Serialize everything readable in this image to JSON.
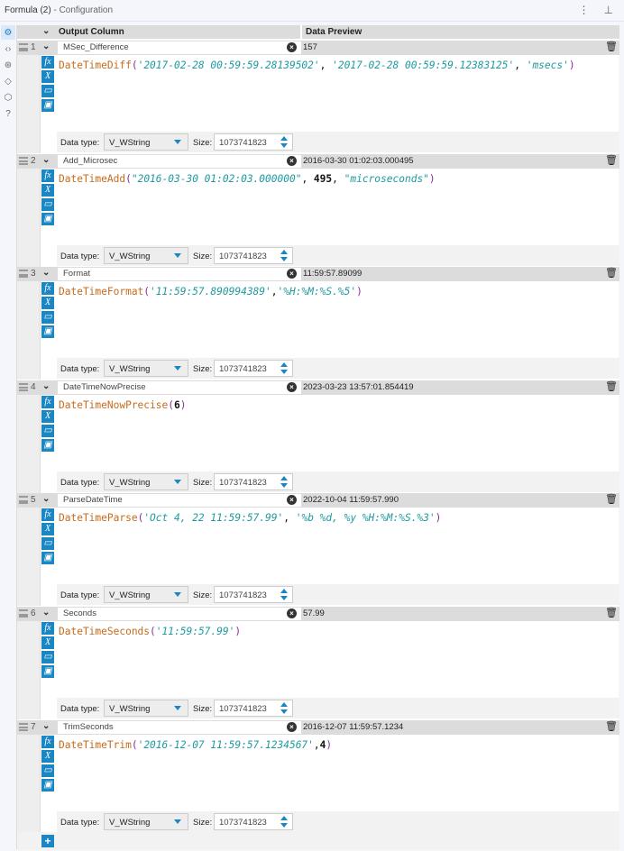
{
  "header": {
    "title": "Formula (2)",
    "subtitle": "- Configuration"
  },
  "table": {
    "col_output": "Output Column",
    "col_preview": "Data Preview"
  },
  "labels": {
    "data_type": "Data type:",
    "size": "Size:"
  },
  "rows": [
    {
      "num": "1",
      "name": "MSec_Difference",
      "preview": "157",
      "type": "V_WString",
      "size": "1073741823",
      "formula": [
        {
          "t": "DateTimeDiff",
          "c": "fn"
        },
        {
          "t": "(",
          "c": "pn"
        },
        {
          "t": "'2017-02-28 00:59:59.28139502'",
          "c": "str"
        },
        {
          "t": ", ",
          "c": "pl"
        },
        {
          "t": "'2017-02-28 00:59:59.12383125'",
          "c": "str"
        },
        {
          "t": ", ",
          "c": "pl"
        },
        {
          "t": "'msecs'",
          "c": "str"
        },
        {
          "t": ")",
          "c": "pn"
        }
      ]
    },
    {
      "num": "2",
      "name": "Add_Microsec",
      "preview": "2016-03-30 01:02:03.000495",
      "type": "V_WString",
      "size": "1073741823",
      "formula": [
        {
          "t": "DateTimeAdd",
          "c": "fn"
        },
        {
          "t": "(",
          "c": "pn"
        },
        {
          "t": "\"2016-03-30 01:02:03.000000\"",
          "c": "str"
        },
        {
          "t": ", ",
          "c": "pl"
        },
        {
          "t": "495",
          "c": "num-t"
        },
        {
          "t": ", ",
          "c": "pl"
        },
        {
          "t": "\"microseconds\"",
          "c": "str"
        },
        {
          "t": ")",
          "c": "pn"
        }
      ]
    },
    {
      "num": "3",
      "name": "Format",
      "preview": "11:59:57.89099",
      "type": "V_WString",
      "size": "1073741823",
      "formula": [
        {
          "t": "DateTimeFormat",
          "c": "fn"
        },
        {
          "t": "(",
          "c": "pn"
        },
        {
          "t": "'11:59:57.890994389'",
          "c": "str"
        },
        {
          "t": ",",
          "c": "pl"
        },
        {
          "t": "'%H:%M:%S.%5'",
          "c": "str"
        },
        {
          "t": ")",
          "c": "pn"
        }
      ]
    },
    {
      "num": "4",
      "name": "DateTimeNowPrecise",
      "preview": "2023-03-23 13:57:01.854419",
      "type": "V_WString",
      "size": "1073741823",
      "formula": [
        {
          "t": "DateTimeNowPrecise",
          "c": "fn"
        },
        {
          "t": "(",
          "c": "pn"
        },
        {
          "t": "6",
          "c": "num-t"
        },
        {
          "t": ")",
          "c": "pn"
        }
      ]
    },
    {
      "num": "5",
      "name": "ParseDateTime",
      "preview": "2022-10-04 11:59:57.990",
      "type": "V_WString",
      "size": "1073741823",
      "formula": [
        {
          "t": "DateTimeParse",
          "c": "fn"
        },
        {
          "t": "(",
          "c": "pn"
        },
        {
          "t": "'Oct 4, 22 11:59:57.99'",
          "c": "str"
        },
        {
          "t": ", ",
          "c": "pl"
        },
        {
          "t": "'%b %d, %y %H:%M:%S.%3'",
          "c": "str"
        },
        {
          "t": ")",
          "c": "pn"
        }
      ]
    },
    {
      "num": "6",
      "name": "Seconds",
      "preview": "57.99",
      "type": "V_WString",
      "size": "1073741823",
      "formula": [
        {
          "t": "DateTimeSeconds",
          "c": "fn"
        },
        {
          "t": "(",
          "c": "pn"
        },
        {
          "t": "'11:59:57.99'",
          "c": "str"
        },
        {
          "t": ")",
          "c": "pn"
        }
      ]
    },
    {
      "num": "7",
      "name": "TrimSeconds",
      "preview": "2016-12-07 11:59:57.1234",
      "type": "V_WString",
      "size": "1073741823",
      "formula": [
        {
          "t": "DateTimeTrim",
          "c": "fn"
        },
        {
          "t": "(",
          "c": "pn"
        },
        {
          "t": "'2016-12-07 11:59:57.1234567'",
          "c": "str"
        },
        {
          "t": ",",
          "c": "pl"
        },
        {
          "t": "4",
          "c": "num-t"
        },
        {
          "t": ")",
          "c": "pn"
        }
      ]
    }
  ]
}
